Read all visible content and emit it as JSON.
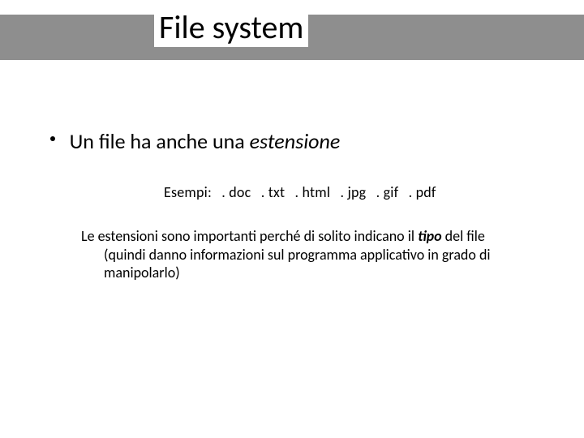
{
  "title": "File system",
  "bullet": {
    "pre": "Un file ha anche una ",
    "emph": "estensione"
  },
  "examples": {
    "label": "Esempi:",
    "items": [
      ". doc",
      ". txt",
      ". html",
      ". jpg",
      ". gif",
      ". pdf"
    ]
  },
  "paragraph": {
    "line1_pre": "Le estensioni sono importanti perché di solito indicano il ",
    "tipo": "tipo",
    "line1_post": " del file",
    "rest": "(quindi danno informazioni sul programma applicativo in grado di manipolarlo)"
  }
}
